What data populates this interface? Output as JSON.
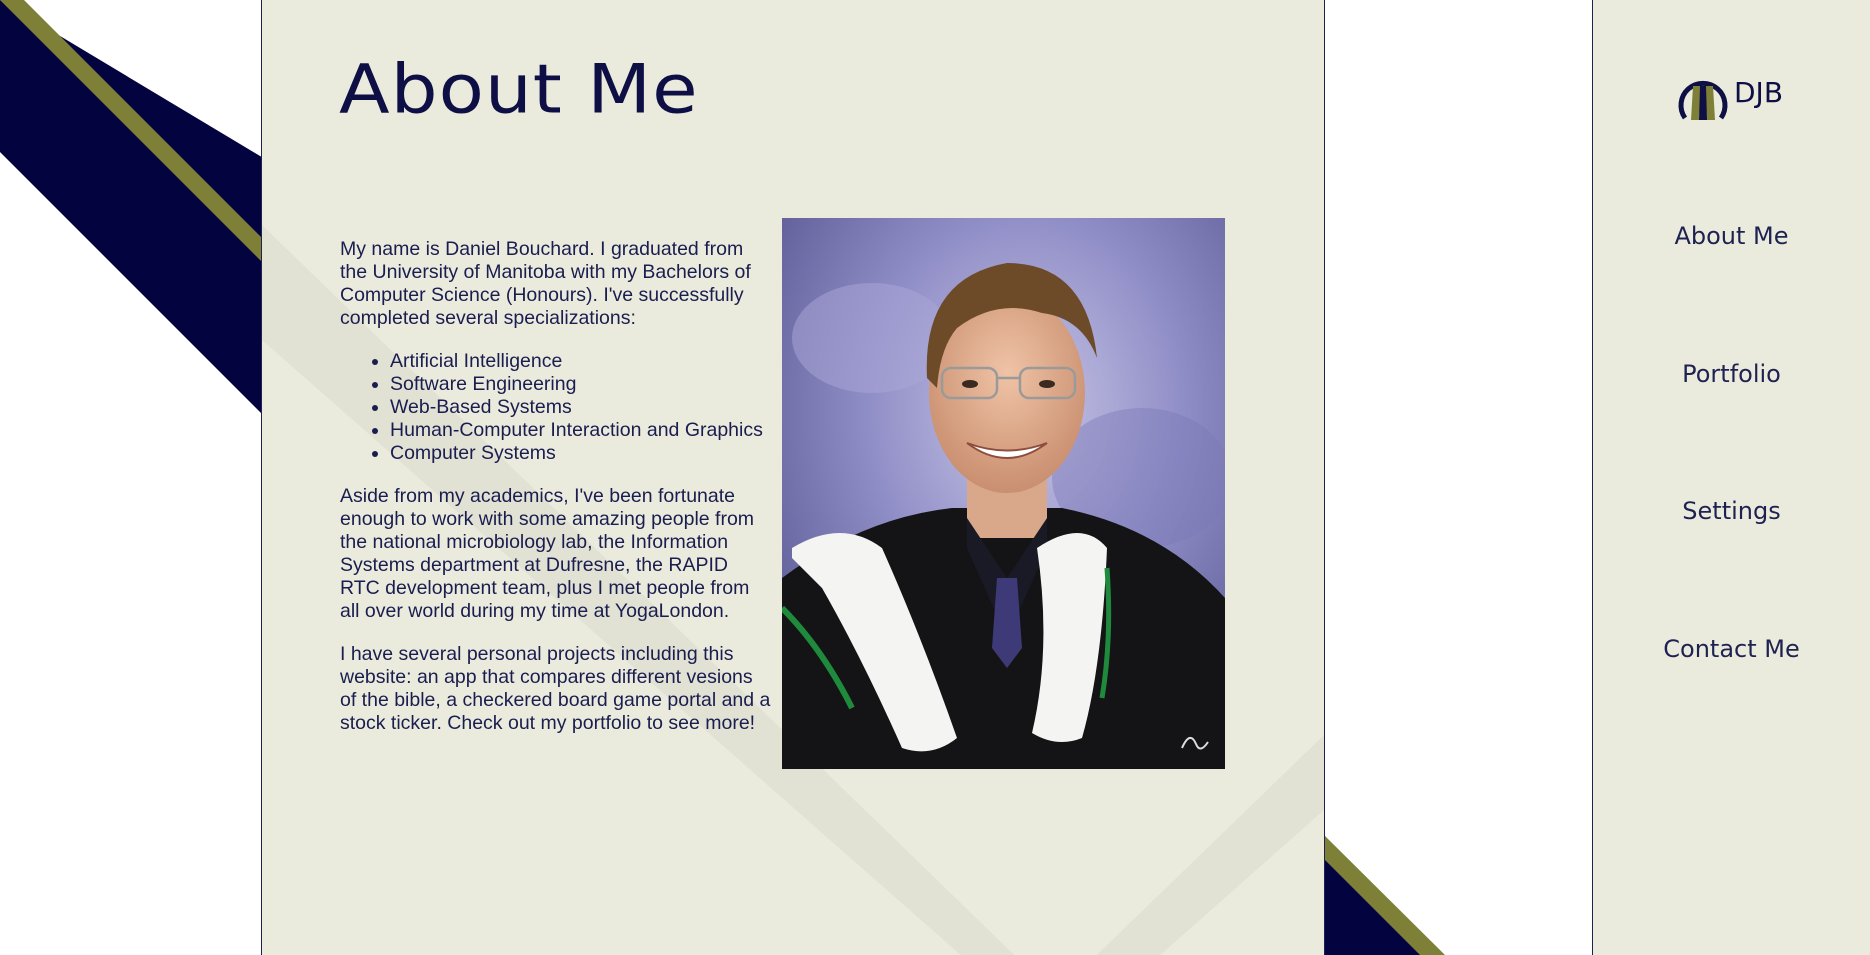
{
  "page": {
    "title": "About Me",
    "colors": {
      "navy": "#03033f",
      "olive": "#7e8038",
      "panel": "#ebebdd",
      "text": "#1a1d4f"
    }
  },
  "bio": {
    "intro": "My name is Daniel Bouchard. I graduated from the University of Manitoba with my Bachelors of Computer Science (Honours). I've successfully completed several specializations:",
    "specializations": [
      "Artificial Intelligence",
      "Software Engineering",
      "Web-Based Systems",
      "Human-Computer Interaction and Graphics",
      "Computer Systems"
    ],
    "work": "Aside from my academics, I've been fortunate enough to work with some amazing people from the national microbiology lab, the Information Systems department at Dufresne, the RAPID RTC development team, plus I met people from all over world during my time at YogaLondon.",
    "projects": "I have several personal projects including this website: an app that compares different vesions of the bible, a checkered board game portal and a stock ticker. Check out my portfolio to see more!"
  },
  "portrait": {
    "subject": "graduation portrait photo"
  },
  "nav": {
    "logo_text": "DJB",
    "items": [
      {
        "label": "About Me"
      },
      {
        "label": "Portfolio"
      },
      {
        "label": "Settings"
      },
      {
        "label": "Contact Me"
      }
    ]
  }
}
